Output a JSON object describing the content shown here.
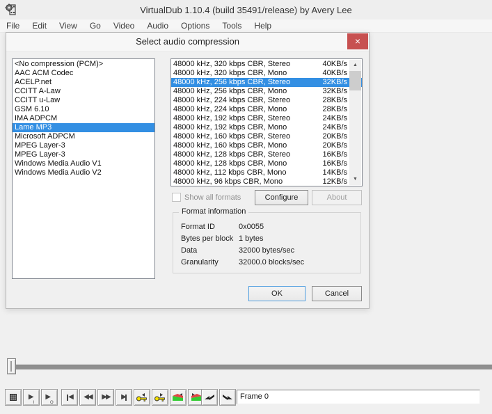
{
  "window": {
    "title": "VirtualDub 1.10.4 (build 35491/release) by Avery Lee",
    "app_icon": "virtualdub-film-gear-icon"
  },
  "menu": {
    "items": [
      "File",
      "Edit",
      "View",
      "Go",
      "Video",
      "Audio",
      "Options",
      "Tools",
      "Help"
    ]
  },
  "dialog": {
    "title": "Select audio compression",
    "close_glyph": "×",
    "codec_list": {
      "selected_index": 7,
      "items": [
        "<No compression (PCM)>",
        "AAC ACM Codec",
        "ACELP.net",
        "CCITT A-Law",
        "CCITT u-Law",
        "GSM 6.10",
        "IMA ADPCM",
        "Lame MP3",
        "Microsoft ADPCM",
        "MPEG Layer-3",
        "MPEG Layer-3",
        "Windows Media Audio V1",
        "Windows Media Audio V2"
      ]
    },
    "format_list": {
      "selected_index": 2,
      "items": [
        {
          "label": "48000 kHz, 320 kbps CBR, Stereo",
          "rate": "40KB/s"
        },
        {
          "label": "48000 kHz, 320 kbps CBR, Mono",
          "rate": "40KB/s"
        },
        {
          "label": "48000 kHz, 256 kbps CBR, Stereo",
          "rate": "32KB/s"
        },
        {
          "label": "48000 kHz, 256 kbps CBR, Mono",
          "rate": "32KB/s"
        },
        {
          "label": "48000 kHz, 224 kbps CBR, Stereo",
          "rate": "28KB/s"
        },
        {
          "label": "48000 kHz, 224 kbps CBR, Mono",
          "rate": "28KB/s"
        },
        {
          "label": "48000 kHz, 192 kbps CBR, Stereo",
          "rate": "24KB/s"
        },
        {
          "label": "48000 kHz, 192 kbps CBR, Mono",
          "rate": "24KB/s"
        },
        {
          "label": "48000 kHz, 160 kbps CBR, Stereo",
          "rate": "20KB/s"
        },
        {
          "label": "48000 kHz, 160 kbps CBR, Mono",
          "rate": "20KB/s"
        },
        {
          "label": "48000 kHz, 128 kbps CBR, Stereo",
          "rate": "16KB/s"
        },
        {
          "label": "48000 kHz, 128 kbps CBR, Mono",
          "rate": "16KB/s"
        },
        {
          "label": "48000 kHz, 112 kbps CBR, Mono",
          "rate": "14KB/s"
        },
        {
          "label": "48000 kHz, 96 kbps CBR, Mono",
          "rate": "12KB/s"
        }
      ]
    },
    "show_all_formats": {
      "label": "Show all formats",
      "checked": false,
      "enabled": false
    },
    "configure_label": "Configure",
    "about_label": "About",
    "format_info": {
      "title": "Format information",
      "rows": [
        {
          "label": "Format ID",
          "value": "0x0055"
        },
        {
          "label": "Bytes per block",
          "value": "1 bytes"
        },
        {
          "label": "Data",
          "value": "32000 bytes/sec"
        },
        {
          "label": "Granularity",
          "value": "32000.0 blocks/sec"
        }
      ]
    },
    "ok_label": "OK",
    "cancel_label": "Cancel"
  },
  "transport": {
    "buttons": [
      {
        "name": "stop",
        "icon": "stop-icon"
      },
      {
        "name": "play-input",
        "icon": "play-input-icon"
      },
      {
        "name": "play-output",
        "icon": "play-output-icon"
      },
      {
        "name": "goto-start",
        "icon": "skip-to-start-icon"
      },
      {
        "name": "step-back",
        "icon": "double-left-arrow-icon"
      },
      {
        "name": "step-forward",
        "icon": "double-right-arrow-icon"
      },
      {
        "name": "goto-end",
        "icon": "skip-to-end-icon"
      },
      {
        "name": "prev-keyframe",
        "icon": "key-left-icon"
      },
      {
        "name": "next-keyframe",
        "icon": "key-right-icon"
      },
      {
        "name": "scene-reverse",
        "icon": "scene-flag-left-icon"
      },
      {
        "name": "scene-forward",
        "icon": "scene-flag-right-icon"
      },
      {
        "name": "mark-in",
        "icon": "mark-in-arrow-icon"
      },
      {
        "name": "mark-out",
        "icon": "mark-out-arrow-icon"
      }
    ]
  },
  "status": {
    "frame_label": "Frame 0"
  },
  "colors": {
    "selection_blue": "#338fe3",
    "close_button_red": "#c75050",
    "key_yellow": "#f5e000",
    "scene_green": "#33cc33",
    "scene_red": "#e04545"
  }
}
